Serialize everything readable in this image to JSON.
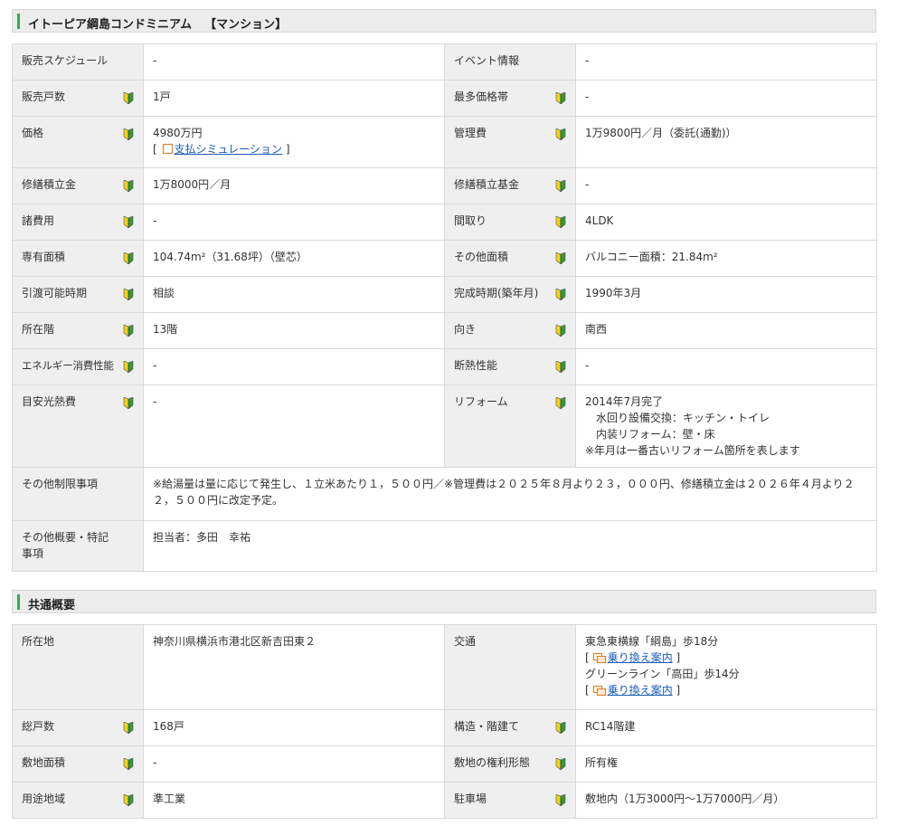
{
  "section1": {
    "title": "イトーピア綱島コンドミニアム",
    "subtitle": "【マンション】",
    "rows": [
      {
        "l1": "販売スケジュール",
        "v1": "-",
        "l2": "イベント情報",
        "v2": "-"
      },
      {
        "l1": "販売戸数",
        "v1": "1戸",
        "l2": "最多価格帯",
        "v2": "-"
      },
      {
        "l1": "価格",
        "v1": "4980万円",
        "l2": "管理費",
        "v2": "1万9800円／月（委託(通勤)）"
      },
      {
        "l1": "修繕積立金",
        "v1": "1万8000円／月",
        "l2": "修繕積立基金",
        "v2": "-"
      },
      {
        "l1": "諸費用",
        "v1": "-",
        "l2": "間取り",
        "v2": "4LDK"
      },
      {
        "l1": "専有面積",
        "v1": "104.74m²（31.68坪）（壁芯）",
        "l2": "その他面積",
        "v2": "バルコニー面積：21.84m²"
      },
      {
        "l1": "引渡可能時期",
        "v1": "相談",
        "l2": "完成時期(築年月)",
        "v2": "1990年3月"
      },
      {
        "l1": "所在階",
        "v1": "13階",
        "l2": "向き",
        "v2": "南西"
      },
      {
        "l1": "エネルギー消費性能",
        "v1": "-",
        "l2": "断熱性能",
        "v2": "-"
      },
      {
        "l1": "目安光熱費",
        "v1": "-",
        "l2": "リフォーム",
        "v2": "2014年7月完了"
      }
    ],
    "price_link": "支払シミュレーション",
    "reform_lines": [
      "水回り設備交換：キッチン・トイレ",
      "内装リフォーム：壁・床",
      "※年月は一番古いリフォーム箇所を表します"
    ],
    "restrictions_label": "その他制限事項",
    "restrictions_value": "※給湯量は量に応じて発生し、１立米あたり１，５００円／※管理費は２０２５年８月より２３，０００円、修繕積立金は２０２６年４月より２２，５００円に改定予定。",
    "notes_label": "その他概要・特記事項",
    "notes_value": "担当者：多田　幸祐"
  },
  "section2": {
    "title": "共通概要",
    "address_label": "所在地",
    "address_value": "神奈川県横浜市港北区新吉田東２",
    "traffic_label": "交通",
    "traffic_line1": "東急東横線「綱島」歩18分",
    "traffic_line2": "グリーンライン「高田」歩14分",
    "transfer_link": "乗り換え案内",
    "rows": [
      {
        "l1": "総戸数",
        "v1": "168戸",
        "l2": "構造・階建て",
        "v2": "RC14階建"
      },
      {
        "l1": "敷地面積",
        "v1": "-",
        "l2": "敷地の権利形態",
        "v2": "所有権"
      },
      {
        "l1": "用途地域",
        "v1": "準工業",
        "l2": "駐車場",
        "v2": "敷地内（1万3000円～1万7000円／月）"
      }
    ]
  },
  "icons": {
    "beginner": "beginner-mark-icon",
    "calc": "calculator-icon",
    "transfer": "transfer-icon"
  },
  "colors": {
    "accent": "#3da45a",
    "link": "#1a5db4",
    "label_bg": "#efefef",
    "header_bg": "#ececec"
  }
}
